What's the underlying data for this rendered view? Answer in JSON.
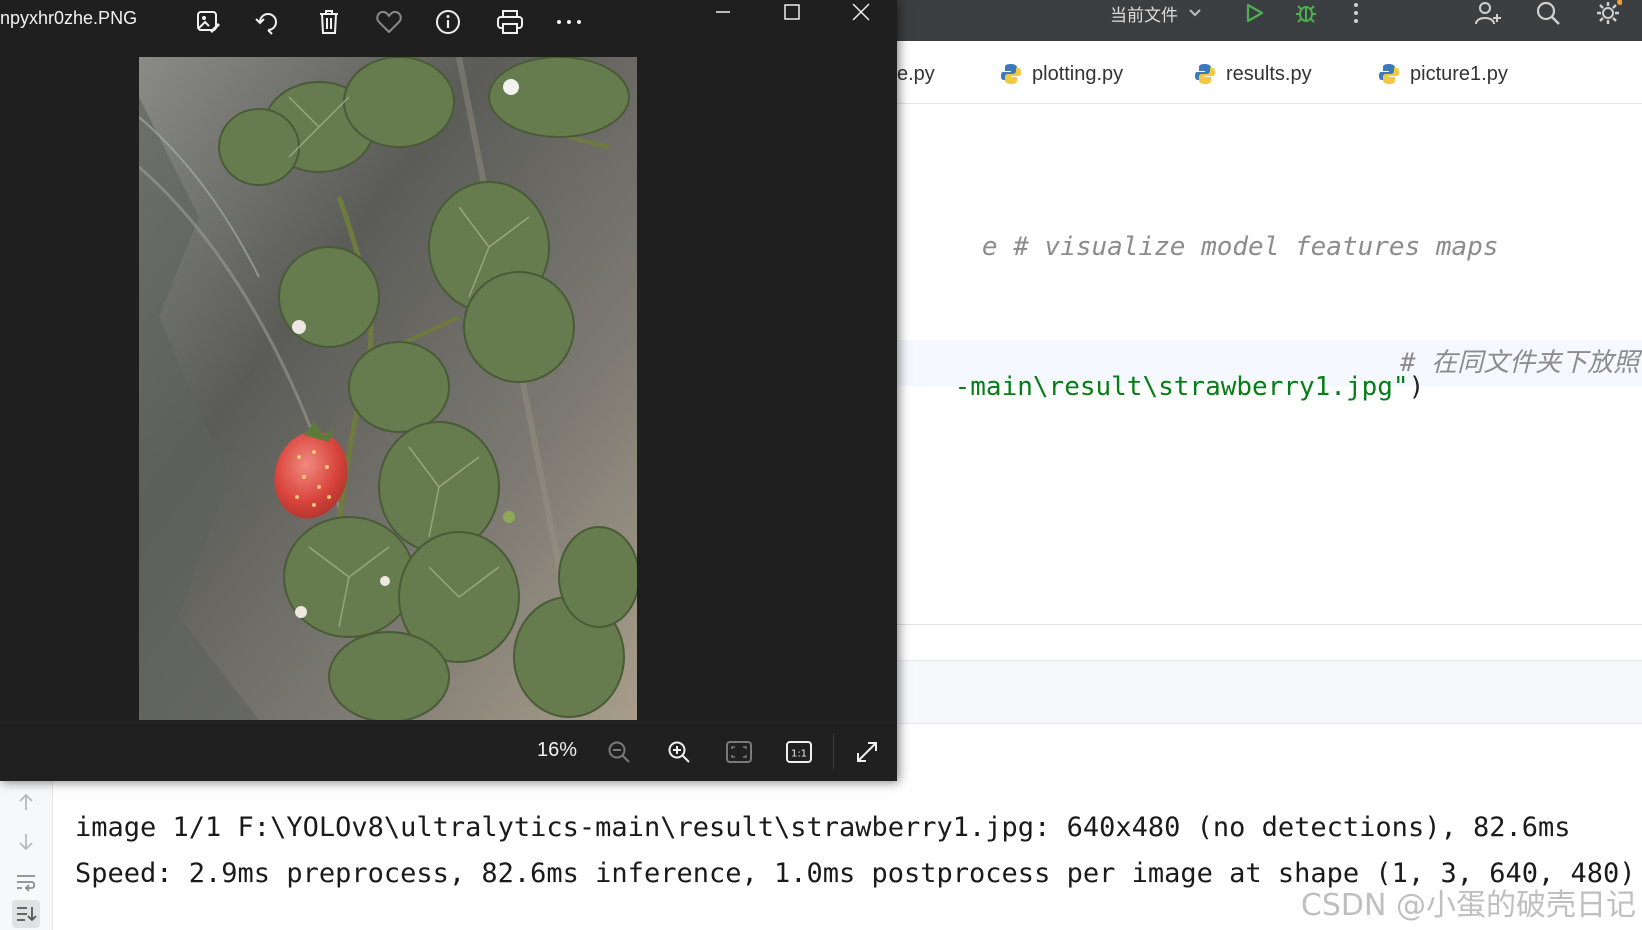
{
  "ide": {
    "run_config_label": "当前文件",
    "tabs": [
      {
        "label": "e.py"
      },
      {
        "label": "plotting.py"
      },
      {
        "label": "results.py"
      },
      {
        "label": "picture1.py"
      }
    ],
    "code": {
      "line1_prefix": "e ",
      "line1_comment": "# visualize model features maps",
      "line2_string": "-main\\result\\strawberry1.jpg\"",
      "line2_paren": ")",
      "line2_comment": "# 在同文件夹下放照"
    },
    "console": {
      "line1": "image 1/1 F:\\YOLOv8\\ultralytics-main\\result\\strawberry1.jpg: 640x480 (no detections), 82.6ms",
      "line2": "Speed: 2.9ms preprocess, 82.6ms inference, 1.0ms postprocess per image at shape (1, 3, 640, 480)"
    },
    "watermark": "CSDN @小蛋的破壳日记"
  },
  "viewer": {
    "filename": "npyxhr0zhe.PNG",
    "zoom_label": "16%",
    "toolbar_icons": [
      "edit-image-icon",
      "rotate-icon",
      "delete-icon",
      "favorite-icon",
      "info-icon",
      "print-icon",
      "more-icon"
    ],
    "bottom_icons": [
      "zoom-out-icon",
      "zoom-in-icon",
      "fit-to-window-icon",
      "actual-size-icon",
      "fullscreen-icon"
    ],
    "actual_size_label": "1:1"
  },
  "colors": {
    "ide_toolbar": "#3c3f41",
    "viewer_bg": "#1f1f1f",
    "string_green": "#067d17",
    "comment_gray": "#8c8c8c",
    "run_green": "#4caf50"
  }
}
